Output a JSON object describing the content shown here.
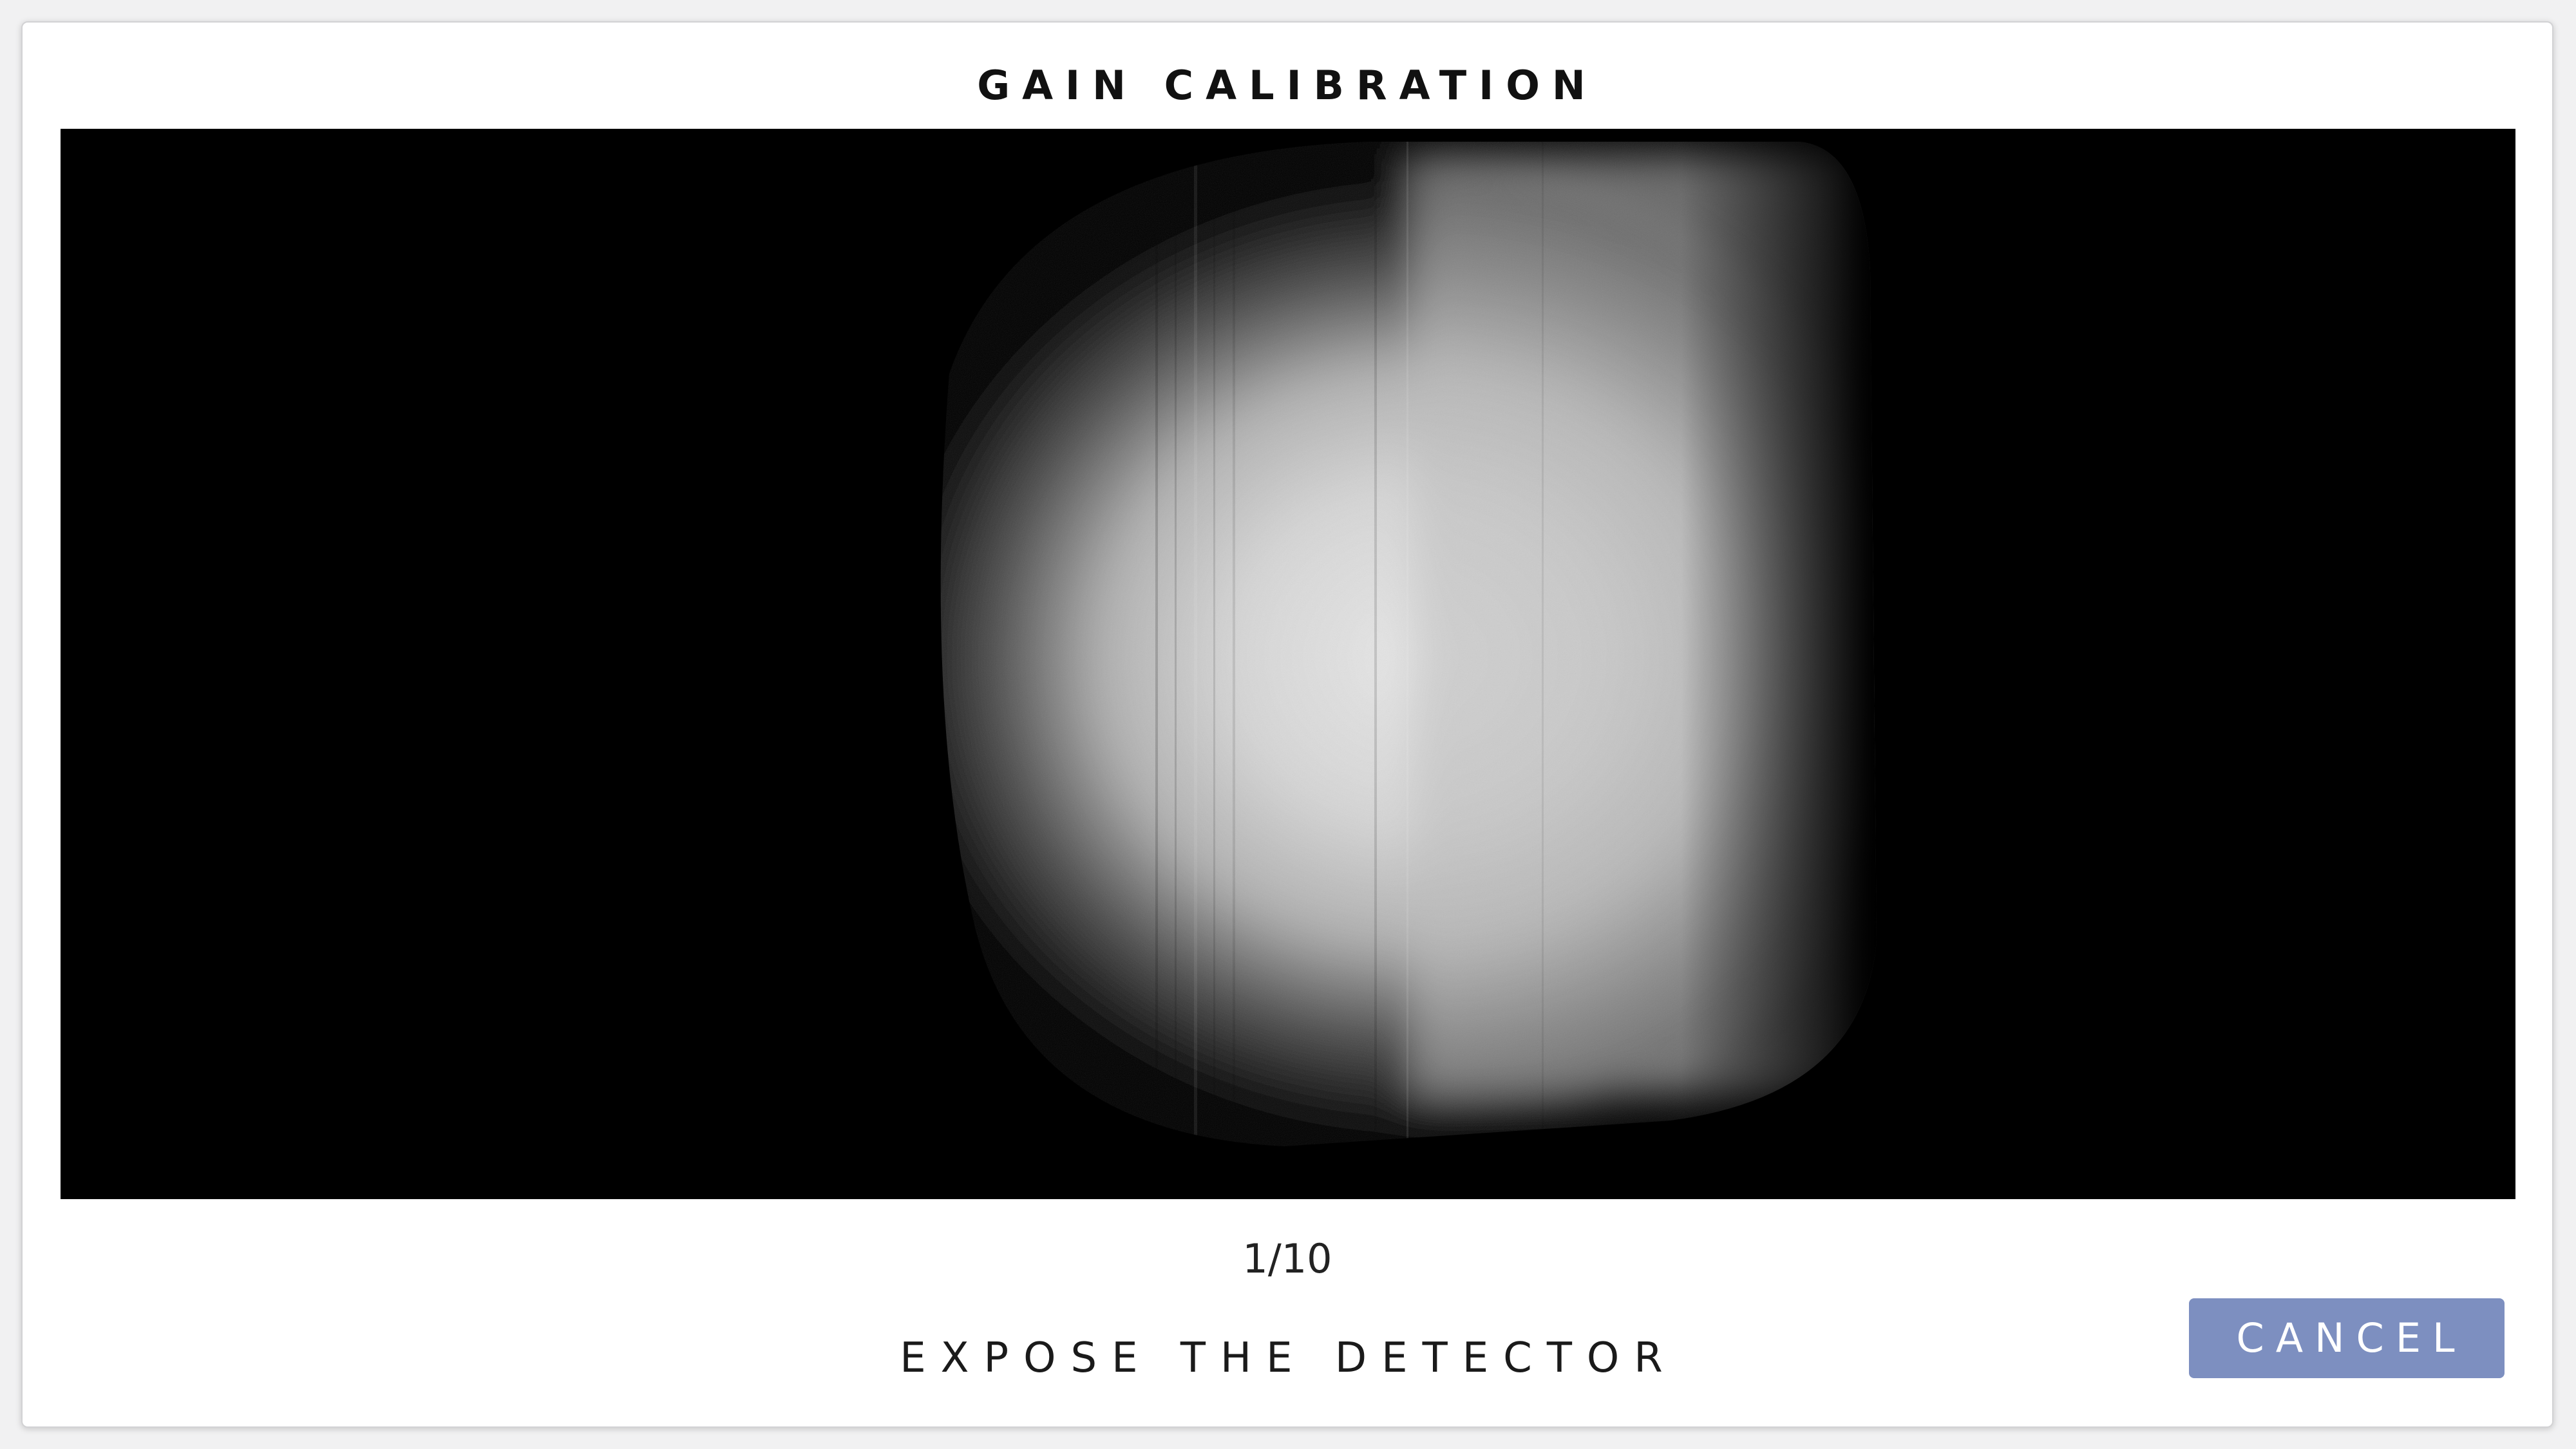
{
  "dialog": {
    "title": "GAIN CALIBRATION",
    "progress": {
      "text": "1/10",
      "current": 1,
      "total": 10
    },
    "instruction": "EXPOSE THE DETECTOR",
    "cancel_label": "CANCEL"
  },
  "colors": {
    "button_bg": "#7d8fc0",
    "button_text": "#ffffff",
    "viewer_bg": "#000000"
  }
}
